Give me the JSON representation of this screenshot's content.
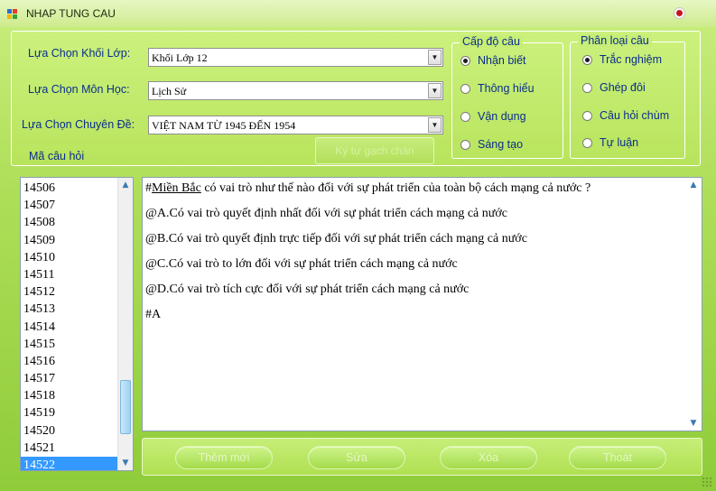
{
  "window": {
    "title": "NHAP TUNG CAU"
  },
  "filters": {
    "khoi_lop": {
      "label": "Lựa Chọn Khối Lớp:",
      "value": "Khối Lớp 12"
    },
    "mon_hoc": {
      "label": "Lựa Chọn Môn Học:",
      "value": "Lịch Sử"
    },
    "chuyen_de": {
      "label": "Lựa Chọn Chuyên Đề:",
      "value": "VIỆT NAM TỪ 1945 ĐẾN 1954"
    },
    "ma_cau_hoi_label": "Mã câu hỏi",
    "underline_button": "Ký tự gạch chân"
  },
  "cap_do": {
    "legend": "Cấp độ câu",
    "options": [
      "Nhận biết",
      "Thông hiểu",
      "Vận dụng",
      "Sáng tạo"
    ],
    "selected": "Nhận biết"
  },
  "phan_loai": {
    "legend": "Phân loại câu",
    "options": [
      "Trắc nghiệm",
      "Ghép đôi",
      "Câu hỏi chùm",
      "Tự luận"
    ],
    "selected": "Trắc nghiệm"
  },
  "question_list": {
    "items": [
      "14506",
      "14507",
      "14508",
      "14509",
      "14510",
      "14511",
      "14512",
      "14513",
      "14514",
      "14515",
      "14516",
      "14517",
      "14518",
      "14519",
      "14520",
      "14521",
      "14522"
    ],
    "selected": "14522",
    "scroll_position": 0.9
  },
  "question_text": {
    "underlined_prefix": "#",
    "underlined_word": "Miền Bắc",
    "first_line_rest": " có vai trò như thế nào đối với sự phát triển của toàn bộ cách mạng cả nước ?",
    "lines": [
      "@A.Có vai trò quyết định nhất đối với sự phát triển cách mạng cả nước",
      "@B.Có vai trò quyết định trực tiếp đối với sự phát triển cách mạng cả  nước",
      "@C.Có vai trò  to  lớn đối với sự phát triển cách mạng cả nước",
      "@D.Có vai trò tích cực đối với sự phát triển cách mạng cả nước",
      "#A"
    ]
  },
  "actions": {
    "add": "Thêm mới",
    "edit": "Sửa",
    "delete": "Xóa",
    "exit": "Thoát"
  }
}
